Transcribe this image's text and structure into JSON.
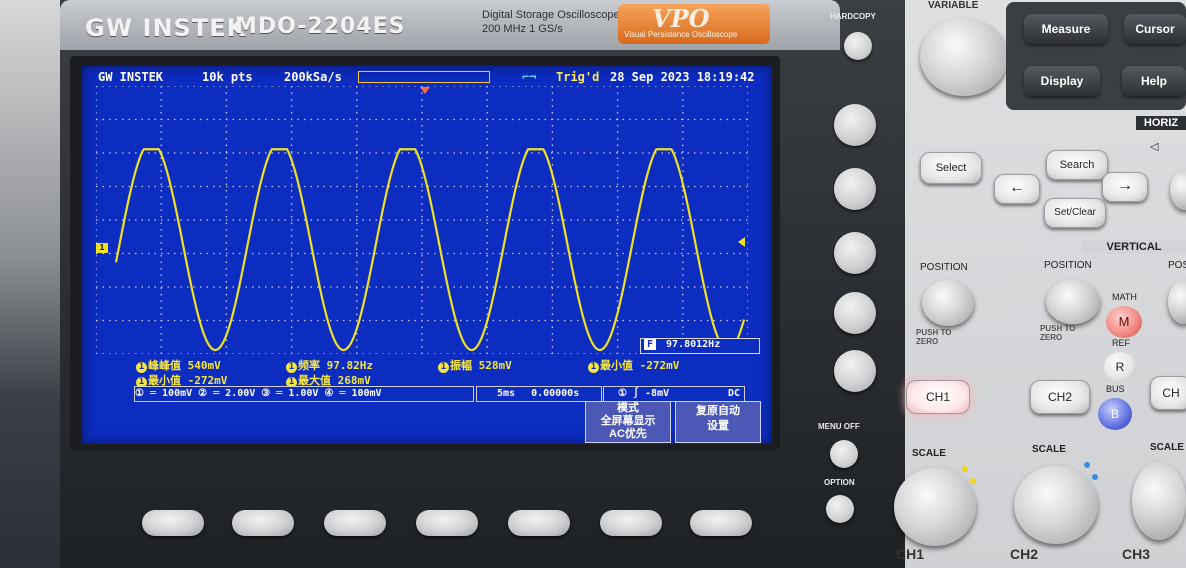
{
  "device": {
    "brand": "GW INSTEK",
    "model": "MDO-2204ES",
    "description_line1": "Digital  Storage  Oscilloscope",
    "description_line2": "200 MHz   1 GS/s",
    "vpo_badge": "VPO",
    "vpo_subtitle": "Visual Persistence Oscilloscope"
  },
  "screen": {
    "brand": "GW INSTEK",
    "record_length": "10k pts",
    "sample_rate": "200kSa/s",
    "trigger_status": "Trig'd",
    "date_time": "28 Sep 2023  18:19:42",
    "channel_marker": "1"
  },
  "measurements": {
    "row1": [
      {
        "ch": "1",
        "label": "峰峰值 540mV"
      },
      {
        "ch": "1",
        "label": "频率 97.82Hz"
      },
      {
        "ch": "1",
        "label": "振幅 528mV"
      },
      {
        "ch": "1",
        "label": "最小值 -272mV"
      }
    ],
    "row2": [
      {
        "ch": "1",
        "label": "最小值 -272mV"
      },
      {
        "ch": "1",
        "label": "最大值 268mV"
      }
    ]
  },
  "frequency_counter": {
    "badge": "F",
    "value": "97.8012Hz"
  },
  "bottom_status": {
    "channels": "① ═ 100mV  ② ═ 2.00V  ③ ═ 1.00V  ④ ═ 100mV",
    "timebase": "5ms",
    "position": "0.00000s",
    "trigger": "① ∫  -8mV",
    "coupling": "DC"
  },
  "softkeys": [
    {
      "lines": [
        "模式",
        "全屏幕显示",
        "AC优先"
      ]
    },
    {
      "lines": [
        "复原自动",
        "设置"
      ]
    }
  ],
  "waveform": {
    "type": "sine",
    "color": "#f0e021",
    "cycles_on_screen": 4.9,
    "amplitude_label": "528mV"
  },
  "bezel_labels": {
    "hardcopy": "HARDCOPY",
    "menu_off": "MENU OFF",
    "option": "OPTION"
  },
  "panel": {
    "variable": "VARIABLE",
    "measure": "Measure",
    "cursor": "Cursor",
    "display": "Display",
    "help": "Help",
    "select": "Select",
    "horizontal": "HORIZ",
    "search": "Search",
    "set_clear": "Set/Clear",
    "left_arrow": "←",
    "right_arrow": "→",
    "vertical": "VERTICAL",
    "position_1": "POSITION",
    "position_2": "POSITION",
    "position_3": "POS",
    "push_to_zero": "PUSH TO ZERO",
    "math": "MATH",
    "math_key": "M",
    "ref": "REF",
    "ref_key": "R",
    "bus": "BUS",
    "bus_key": "B",
    "ch1": "CH1",
    "ch2": "CH2",
    "ch3": "CH",
    "scale_1": "SCALE",
    "scale_2": "SCALE",
    "scale_3": "SCALE",
    "bottom_ch1": "CH1",
    "bottom_ch2": "CH2",
    "bottom_ch3": "CH3"
  }
}
